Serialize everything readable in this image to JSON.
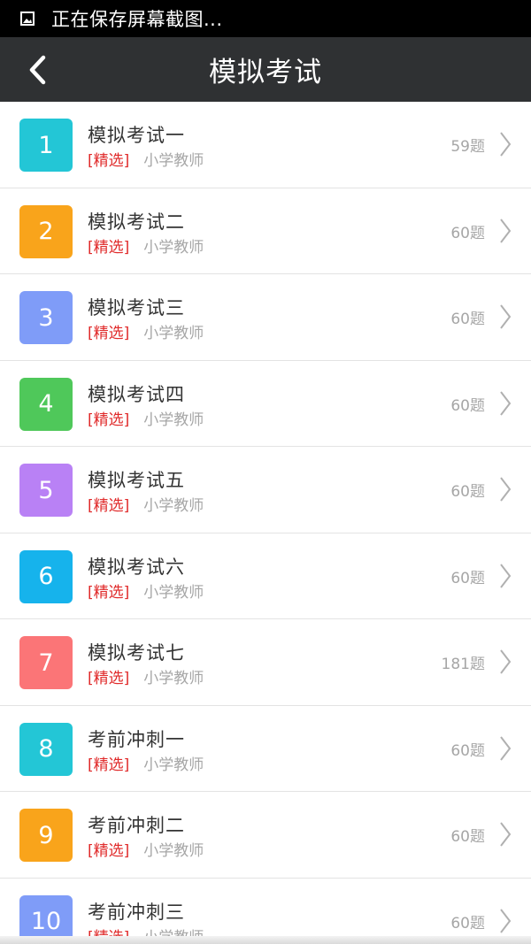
{
  "status_bar": {
    "notification_icon": "image-icon",
    "text": "正在保存屏幕截图..."
  },
  "header": {
    "back_icon": "chevron-left-icon",
    "title": "模拟考试"
  },
  "exams": [
    {
      "number": "1",
      "title": "模拟考试一",
      "tag": "[精选]",
      "category": "小学教师",
      "count": "59题",
      "color": "#23c6d6"
    },
    {
      "number": "2",
      "title": "模拟考试二",
      "tag": "[精选]",
      "category": "小学教师",
      "count": "60题",
      "color": "#f9a41b"
    },
    {
      "number": "3",
      "title": "模拟考试三",
      "tag": "[精选]",
      "category": "小学教师",
      "count": "60题",
      "color": "#7f9cf8"
    },
    {
      "number": "4",
      "title": "模拟考试四",
      "tag": "[精选]",
      "category": "小学教师",
      "count": "60题",
      "color": "#4fc85a"
    },
    {
      "number": "5",
      "title": "模拟考试五",
      "tag": "[精选]",
      "category": "小学教师",
      "count": "60题",
      "color": "#b981f5"
    },
    {
      "number": "6",
      "title": "模拟考试六",
      "tag": "[精选]",
      "category": "小学教师",
      "count": "60题",
      "color": "#16b3ec"
    },
    {
      "number": "7",
      "title": "模拟考试七",
      "tag": "[精选]",
      "category": "小学教师",
      "count": "181题",
      "color": "#fb7577"
    },
    {
      "number": "8",
      "title": "考前冲刺一",
      "tag": "[精选]",
      "category": "小学教师",
      "count": "60题",
      "color": "#23c6d6"
    },
    {
      "number": "9",
      "title": "考前冲刺二",
      "tag": "[精选]",
      "category": "小学教师",
      "count": "60题",
      "color": "#f9a41b"
    },
    {
      "number": "10",
      "title": "考前冲刺三",
      "tag": "[精选]",
      "category": "小学教师",
      "count": "60题",
      "color": "#7f9cf8"
    }
  ]
}
